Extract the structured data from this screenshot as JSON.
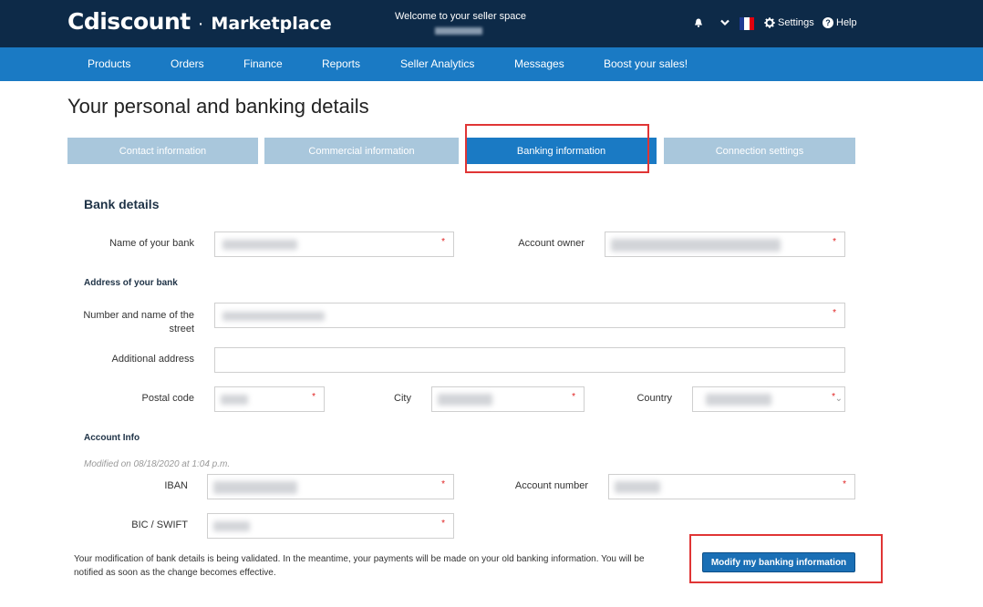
{
  "header": {
    "brand": "Cdiscount",
    "separator": "·",
    "product": "Marketplace",
    "welcome": "Welcome to your seller space",
    "settings_label": "Settings",
    "help_label": "Help",
    "flag_colors": [
      "#1f3a93",
      "#ffffff",
      "#e1000f"
    ]
  },
  "nav": {
    "items": [
      "Products",
      "Orders",
      "Finance",
      "Reports",
      "Seller Analytics",
      "Messages",
      "Boost your sales!"
    ]
  },
  "page": {
    "title": "Your personal and banking details"
  },
  "tabs": [
    {
      "label": "Contact information",
      "active": false
    },
    {
      "label": "Commercial information",
      "active": false
    },
    {
      "label": "Banking information",
      "active": true
    },
    {
      "label": "Connection settings",
      "active": false
    }
  ],
  "form": {
    "section_title": "Bank details",
    "bank_name_label": "Name of your bank",
    "account_owner_label": "Account owner",
    "address_heading": "Address of your bank",
    "street_label": "Number and name of the street",
    "additional_address_label": "Additional address",
    "postal_code_label": "Postal code",
    "city_label": "City",
    "country_label": "Country",
    "account_info_heading": "Account Info",
    "modified_text": "Modified on 08/18/2020 at 1:04 p.m.",
    "iban_label": "IBAN",
    "account_number_label": "Account number",
    "bic_label": "BIC / SWIFT",
    "required_marker": "*",
    "notice": "Your modification of bank details is being validated. In the meantime, your payments will be made on your old banking information. You will be notified as soon as the change becomes effective.",
    "submit_label": "Modify my banking information"
  },
  "colors": {
    "header_bg": "#0d2a48",
    "nav_bg": "#1a7ac4",
    "tab_inactive": "#a9c7dc",
    "tab_active": "#1a7ac4",
    "highlight": "#e03535",
    "required": "#e02020"
  }
}
